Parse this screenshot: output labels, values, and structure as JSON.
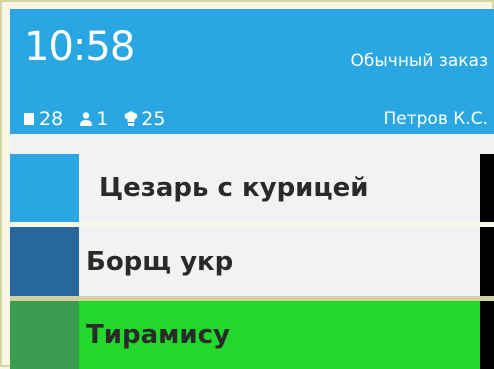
{
  "header": {
    "time": "10:58",
    "order_type": "Обычный заказ",
    "table_number": "28",
    "guest_count": "1",
    "order_number": "25",
    "waiter": "Петров К.С.",
    "icons": {
      "table": "table-icon",
      "guests": "person-icon",
      "order": "chef-hat-icon"
    }
  },
  "dishes": [
    {
      "name": "Цезарь с курицей",
      "color": "#2aa7e3",
      "state": "new"
    },
    {
      "name": "Борщ укр",
      "color": "#27679c",
      "state": "in-progress"
    },
    {
      "name": "Тирамису",
      "color": "#3a9c4e",
      "state": "ready",
      "highlight": "#21d82b"
    }
  ],
  "colors": {
    "header_bg": "#2aa7e3",
    "row_bg": "#f2f2f2",
    "ready_bg": "#21d82b",
    "frame": "#d6d6a2"
  }
}
